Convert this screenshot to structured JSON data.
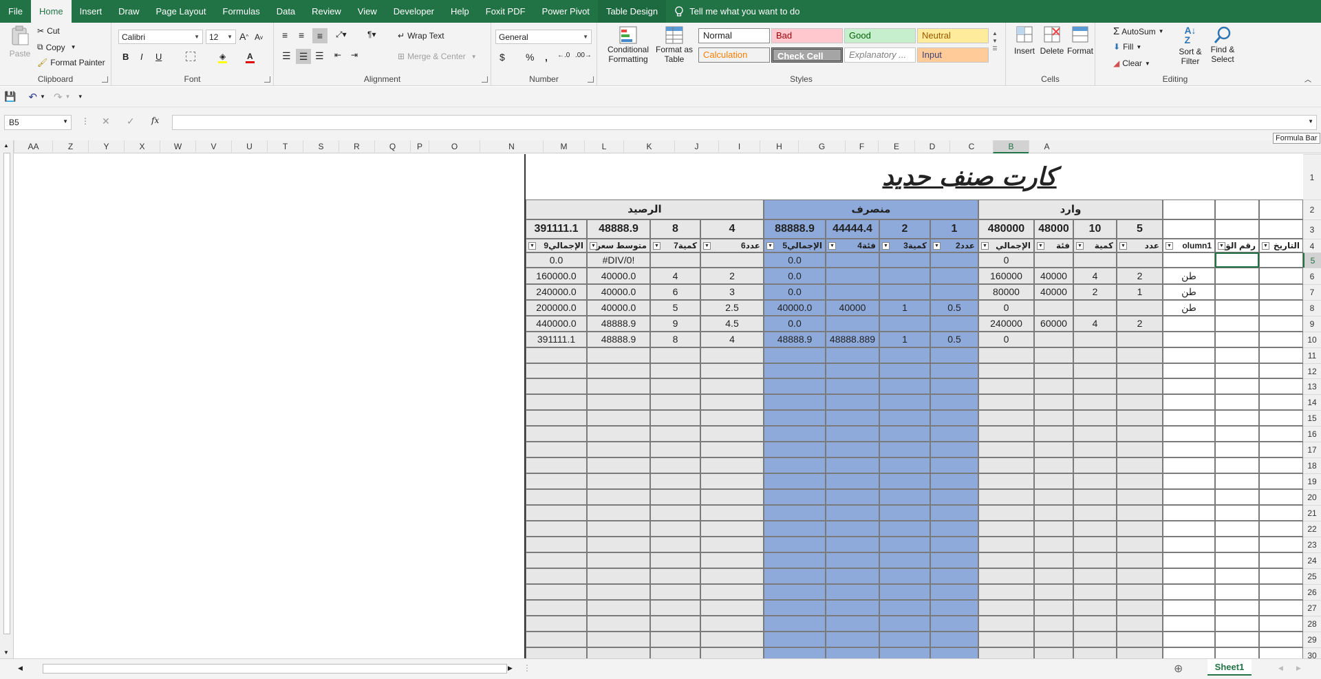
{
  "tabs": [
    "File",
    "Home",
    "Insert",
    "Draw",
    "Page Layout",
    "Formulas",
    "Data",
    "Review",
    "View",
    "Developer",
    "Help",
    "Foxit PDF",
    "Power Pivot",
    "Table Design"
  ],
  "tell_me": "Tell me what you want to do",
  "clipboard": {
    "paste": "Paste",
    "cut": "Cut",
    "copy": "Copy",
    "format_painter": "Format Painter",
    "label": "Clipboard"
  },
  "font": {
    "name": "Calibri",
    "size": "12",
    "bold": "B",
    "italic": "I",
    "underline": "U",
    "label": "Font"
  },
  "alignment": {
    "wrap": "Wrap Text",
    "merge": "Merge & Center",
    "label": "Alignment"
  },
  "number": {
    "format": "General",
    "currency": "$",
    "percent": "%",
    "comma": ",",
    "label": "Number"
  },
  "styles": {
    "conditional": "Conditional",
    "formatting": "Formatting",
    "format_as": "Format as",
    "table": "Table",
    "normal": "Normal",
    "bad": "Bad",
    "good": "Good",
    "neutral": "Neutral",
    "calculation": "Calculation",
    "check_cell": "Check Cell",
    "explanatory": "Explanatory ...",
    "input": "Input",
    "label": "Styles"
  },
  "cells": {
    "insert": "Insert",
    "delete": "Delete",
    "format": "Format",
    "label": "Cells"
  },
  "editing": {
    "autosum": "AutoSum",
    "fill": "Fill",
    "clear": "Clear",
    "sort": "Sort &",
    "filter": "Filter",
    "find": "Find &",
    "select": "Select",
    "label": "Editing"
  },
  "namebox": "B5",
  "fx": "fx",
  "formula_tip": "Formula Bar",
  "columns": [
    "AA",
    "Z",
    "Y",
    "X",
    "W",
    "V",
    "U",
    "T",
    "S",
    "R",
    "Q",
    "P",
    "O",
    "N",
    "M",
    "L",
    "K",
    "J",
    "I",
    "H",
    "G",
    "F",
    "E",
    "D",
    "C",
    "B",
    "A"
  ],
  "rows": [
    "1",
    "2",
    "3",
    "4",
    "5",
    "6",
    "7",
    "8",
    "9",
    "10",
    "11",
    "12",
    "13",
    "14",
    "15",
    "16",
    "17",
    "18",
    "19",
    "20",
    "21",
    "22",
    "23",
    "24",
    "25",
    "26",
    "27",
    "28",
    "29",
    "30"
  ],
  "sheet": {
    "title": "كارت صنف حديد",
    "group_balance": "الرصيد",
    "group_out": "منصرف",
    "group_in": "وارد",
    "row3": [
      "391111.1",
      "48888.9",
      "8",
      "4",
      "88888.9",
      "44444.4",
      "2",
      "1",
      "480000",
      "48000",
      "10",
      "5",
      "",
      "",
      ""
    ],
    "row4": [
      "الإجمالي9",
      "متوسط سعر",
      "كمية7",
      "عدد6",
      "الإجمالي5",
      "فئة4",
      "كمية3",
      "عدد2",
      "الإجمالي",
      "فئة",
      "كمية",
      "عدد",
      "olumn1",
      "رقم الق",
      "التاريخ"
    ],
    "data": [
      [
        "0.0",
        "#DIV/0!",
        "",
        "",
        "0.0",
        "",
        "",
        "",
        "0",
        "",
        "",
        "",
        "",
        "",
        ""
      ],
      [
        "160000.0",
        "40000.0",
        "4",
        "2",
        "0.0",
        "",
        "",
        "",
        "160000",
        "40000",
        "4",
        "2",
        "طن",
        "",
        ""
      ],
      [
        "240000.0",
        "40000.0",
        "6",
        "3",
        "0.0",
        "",
        "",
        "",
        "80000",
        "40000",
        "2",
        "1",
        "طن",
        "",
        ""
      ],
      [
        "200000.0",
        "40000.0",
        "5",
        "2.5",
        "40000.0",
        "40000",
        "1",
        "0.5",
        "0",
        "",
        "",
        "",
        "طن",
        "",
        ""
      ],
      [
        "440000.0",
        "48888.9",
        "9",
        "4.5",
        "0.0",
        "",
        "",
        "",
        "240000",
        "60000",
        "4",
        "2",
        "",
        "",
        ""
      ],
      [
        "391111.1",
        "48888.9",
        "8",
        "4",
        "48888.9",
        "48888.889",
        "1",
        "0.5",
        "0",
        "",
        "",
        "",
        "",
        "",
        ""
      ]
    ]
  },
  "sheet_tab": "Sheet1"
}
